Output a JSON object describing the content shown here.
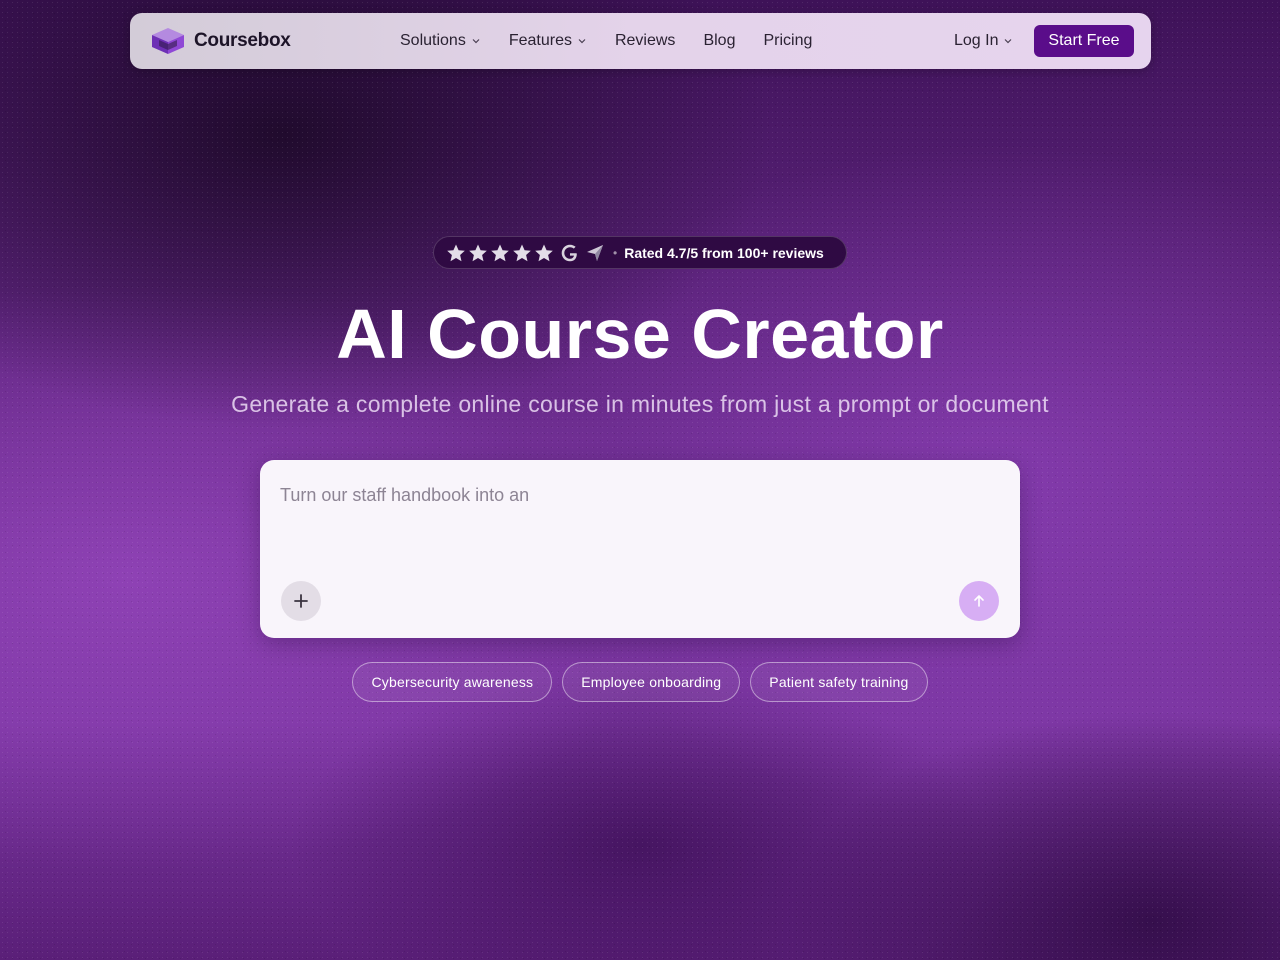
{
  "nav": {
    "logo_text": "Coursebox",
    "menu": [
      {
        "label": "Solutions",
        "has_dropdown": true
      },
      {
        "label": "Features",
        "has_dropdown": true
      },
      {
        "label": "Reviews",
        "has_dropdown": false
      },
      {
        "label": "Blog",
        "has_dropdown": false
      },
      {
        "label": "Pricing",
        "has_dropdown": false
      }
    ],
    "login_label": "Log In",
    "cta_label": "Start Free"
  },
  "rating": {
    "stars": 5,
    "icons": [
      "star-icon",
      "google-icon",
      "capterra-icon"
    ],
    "text": "Rated 4.7/5 from 100+ reviews"
  },
  "hero": {
    "title": "AI Course Creator",
    "subtitle": "Generate a complete online course in minutes from just a prompt or document"
  },
  "prompt": {
    "placeholder": "Turn our staff handbook into an",
    "value": "",
    "attach_icon": "plus-icon",
    "submit_icon": "arrow-up-icon"
  },
  "suggestions": [
    "Cybersecurity awareness",
    "Employee onboarding",
    "Patient safety training"
  ],
  "colors": {
    "brand": "#5a0d8a",
    "submit": "#d7aef4",
    "background": "#6a2b8c"
  }
}
